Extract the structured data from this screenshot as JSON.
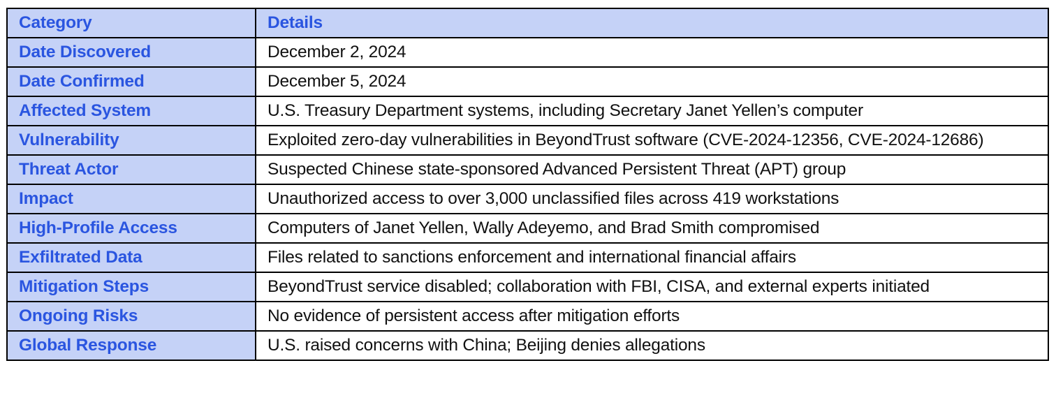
{
  "table": {
    "headers": [
      "Category",
      "Details"
    ],
    "rows": [
      {
        "category": "Date Discovered",
        "details": "December 2, 2024"
      },
      {
        "category": "Date Confirmed",
        "details": "December 5, 2024"
      },
      {
        "category": "Affected System",
        "details": "U.S. Treasury Department systems, including Secretary Janet Yellen’s computer"
      },
      {
        "category": "Vulnerability",
        "details": "Exploited zero-day vulnerabilities in BeyondTrust software (CVE-2024-12356, CVE-2024-12686)"
      },
      {
        "category": "Threat Actor",
        "details": "Suspected Chinese state-sponsored Advanced Persistent Threat (APT) group"
      },
      {
        "category": "Impact",
        "details": "Unauthorized access to over 3,000 unclassified files across 419 workstations"
      },
      {
        "category": "High-Profile Access",
        "details": "Computers of Janet Yellen, Wally Adeyemo, and Brad Smith compromised"
      },
      {
        "category": "Exfiltrated Data",
        "details": "Files related to sanctions enforcement and international financial affairs"
      },
      {
        "category": "Mitigation Steps",
        "details": "BeyondTrust service disabled; collaboration with FBI, CISA, and external experts initiated"
      },
      {
        "category": "Ongoing Risks",
        "details": "No evidence of persistent access after mitigation efforts"
      },
      {
        "category": "Global Response",
        "details": "U.S. raised concerns with China; Beijing denies allegations"
      }
    ]
  },
  "colors": {
    "category_fill": "#c5d2f7",
    "category_text": "#2a55e0",
    "details_text": "#111111",
    "border": "#000000"
  }
}
